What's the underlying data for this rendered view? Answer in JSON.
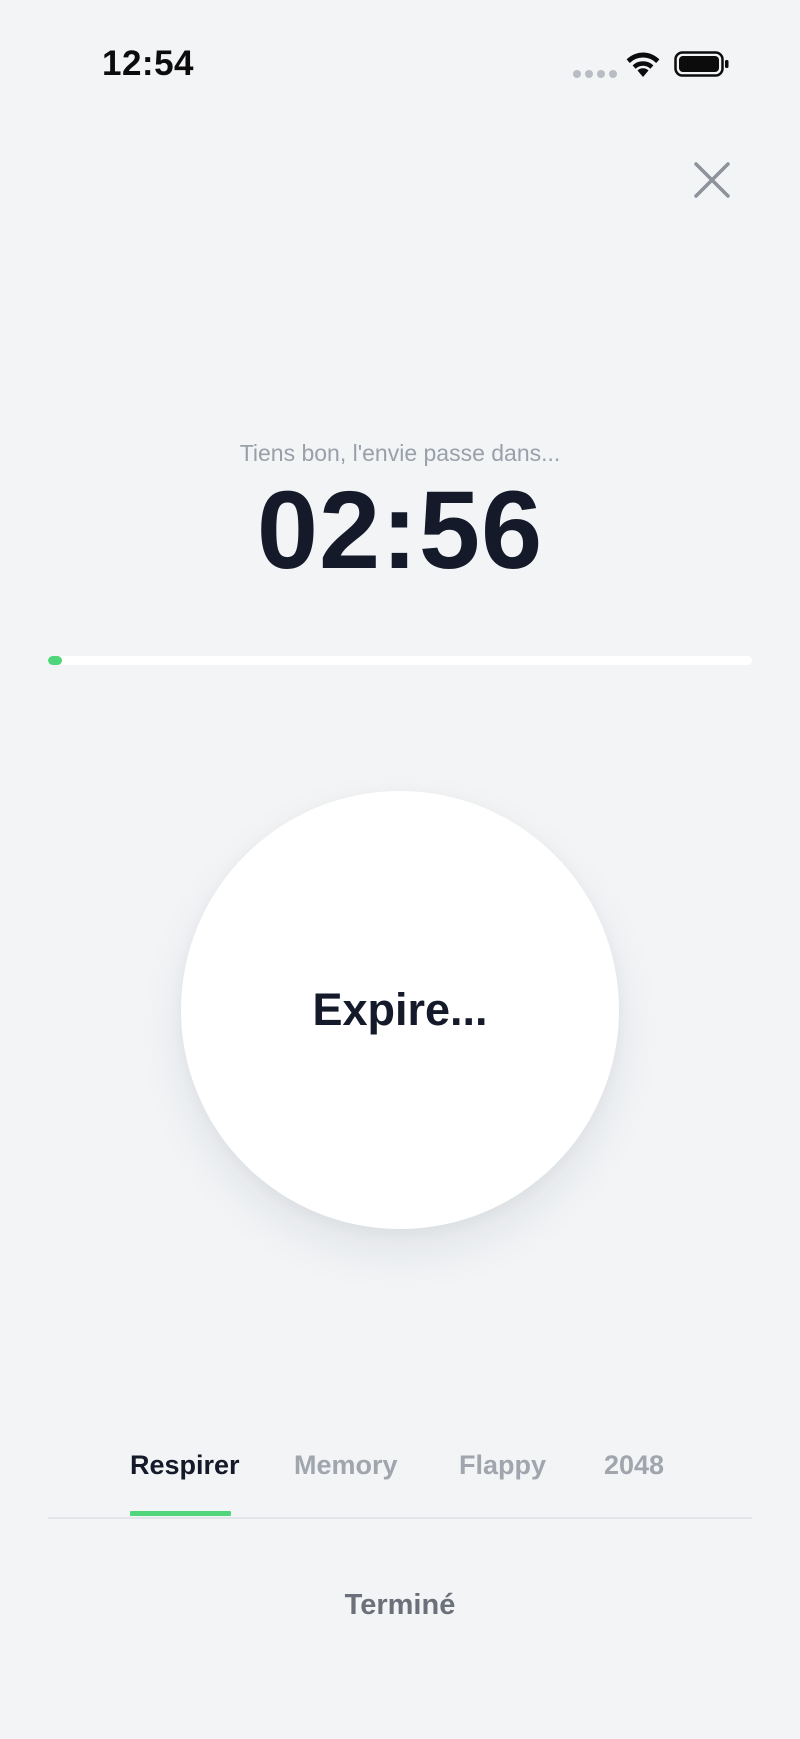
{
  "status_bar": {
    "time": "12:54",
    "icons": [
      "cellular-signal-icon",
      "wifi-icon",
      "battery-icon"
    ]
  },
  "close": {
    "icon": "close-icon",
    "color": "#8e939b"
  },
  "timer": {
    "caption": "Tiens bon, l'envie passe dans...",
    "value": "02:56",
    "progress": 0.02
  },
  "breathing": {
    "label": "Expire..."
  },
  "tabs": [
    {
      "label": "Respirer",
      "active": true
    },
    {
      "label": "Memory",
      "active": false
    },
    {
      "label": "Flappy",
      "active": false
    },
    {
      "label": "2048",
      "active": false
    }
  ],
  "footer": {
    "done_label": "Terminé"
  },
  "colors": {
    "background": "#f2f4f6",
    "accent": "#4fd67a",
    "text_primary": "#141a29",
    "text_muted": "#9aa0a9"
  }
}
